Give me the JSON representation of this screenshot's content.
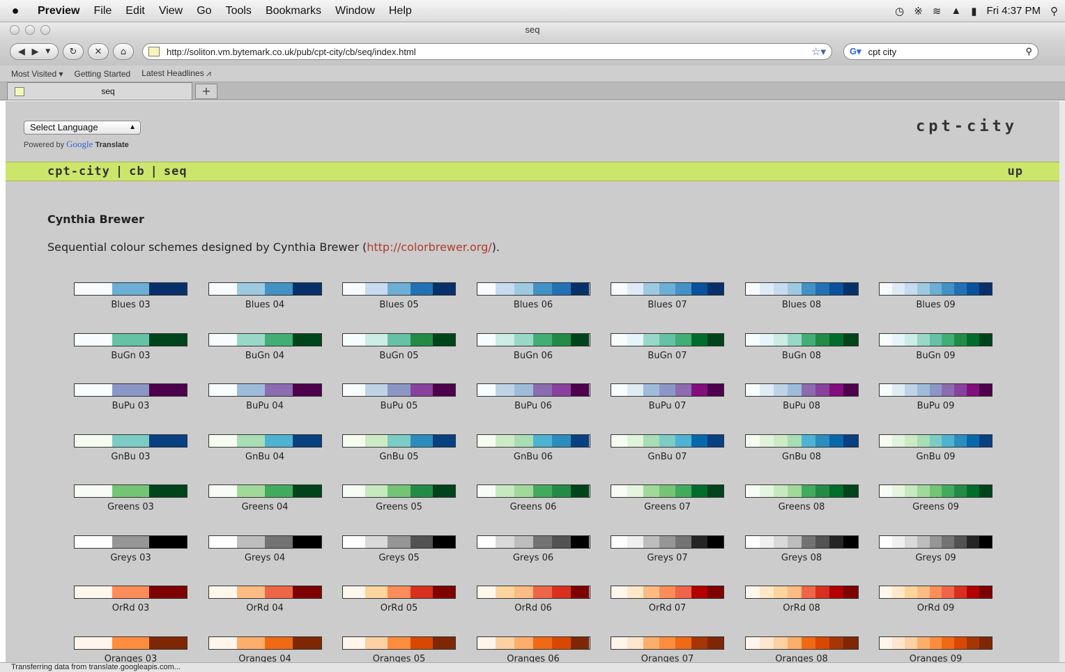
{
  "menubar": {
    "apple": "",
    "items": [
      "Preview",
      "File",
      "Edit",
      "View",
      "Go",
      "Tools",
      "Bookmarks",
      "Window",
      "Help"
    ],
    "clock": "Fri 4:37 PM"
  },
  "window": {
    "title": "seq"
  },
  "navbar": {
    "url": "http://soliton.vm.bytemark.co.uk/pub/cpt-city/cb/seq/index.html",
    "search_query": "cpt city"
  },
  "bookmarks": [
    "Most Visited ▾",
    "Getting Started",
    "Latest Headlines ⩘"
  ],
  "tab": {
    "label": "seq",
    "new_tab": "+"
  },
  "page": {
    "language_select": "Select Language",
    "powered_by": "Powered by",
    "google": "Google",
    "translate": "Translate",
    "brand": "cpt-city",
    "breadcrumb": [
      "cpt-city",
      "cb",
      "seq"
    ],
    "up": "up",
    "heading": "Cynthia Brewer",
    "subtitle_pre": "Sequential colour schemes designed by Cynthia Brewer (",
    "subtitle_link": "http://colorbrewer.org/",
    "subtitle_post": ")."
  },
  "palettes": [
    {
      "name": "Blues",
      "colors": [
        "#f7fbff",
        "#deebf7",
        "#c6dbef",
        "#9ecae1",
        "#6baed6",
        "#4292c6",
        "#2171b5",
        "#08519c",
        "#08306b"
      ]
    },
    {
      "name": "BuGn",
      "colors": [
        "#f7fcfd",
        "#e5f5f9",
        "#ccece6",
        "#99d8c9",
        "#66c2a4",
        "#41ae76",
        "#238b45",
        "#006d2c",
        "#00441b"
      ]
    },
    {
      "name": "BuPu",
      "colors": [
        "#f7fcfd",
        "#e0ecf4",
        "#bfd3e6",
        "#9ebcda",
        "#8c96c6",
        "#8c6bb1",
        "#88419d",
        "#810f7c",
        "#4d004b"
      ]
    },
    {
      "name": "GnBu",
      "colors": [
        "#f7fcf0",
        "#e0f3db",
        "#ccebc5",
        "#a8ddb5",
        "#7bccc4",
        "#4eb3d3",
        "#2b8cbe",
        "#0868ac",
        "#084081"
      ]
    },
    {
      "name": "Greens",
      "colors": [
        "#f7fcf5",
        "#e5f5e0",
        "#c7e9c0",
        "#a1d99b",
        "#74c476",
        "#41ab5d",
        "#238b45",
        "#006d2c",
        "#00441b"
      ]
    },
    {
      "name": "Greys",
      "colors": [
        "#ffffff",
        "#f0f0f0",
        "#d9d9d9",
        "#bdbdbd",
        "#969696",
        "#737373",
        "#525252",
        "#252525",
        "#000000"
      ]
    },
    {
      "name": "OrRd",
      "colors": [
        "#fff7ec",
        "#fee8c8",
        "#fdd49e",
        "#fdbb84",
        "#fc8d59",
        "#ef6548",
        "#d7301f",
        "#b30000",
        "#7f0000"
      ]
    },
    {
      "name": "Oranges",
      "colors": [
        "#fff5eb",
        "#fee6ce",
        "#fdd0a2",
        "#fdae6b",
        "#fd8d3c",
        "#f16913",
        "#d94801",
        "#a63603",
        "#7f2704"
      ]
    }
  ],
  "palette_sizes": [
    "03",
    "04",
    "05",
    "06",
    "07",
    "08",
    "09"
  ],
  "status": "Transferring data from translate.googleapis.com..."
}
